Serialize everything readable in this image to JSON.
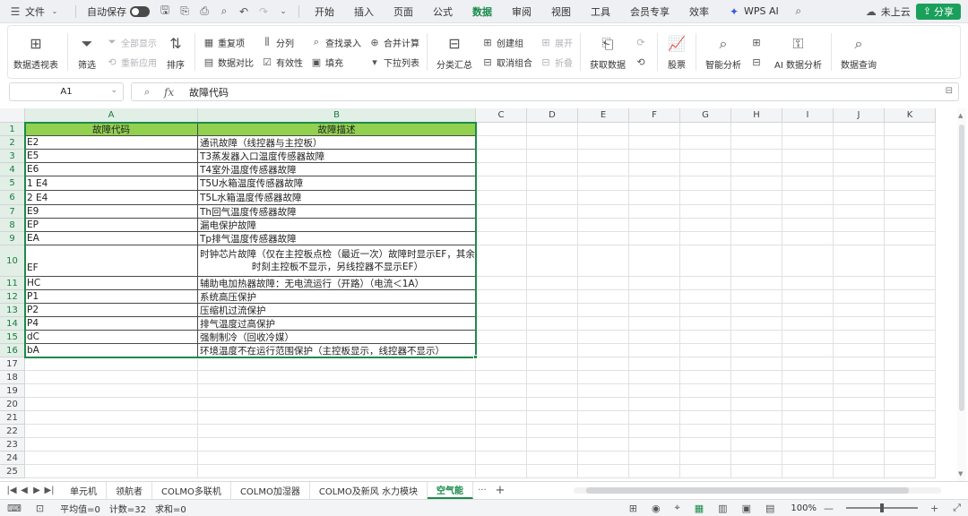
{
  "menubar": {
    "file_label": "文件",
    "autosave_label": "自动保存",
    "tabs": [
      "开始",
      "插入",
      "页面",
      "公式",
      "数据",
      "审阅",
      "视图",
      "工具",
      "会员专享",
      "效率"
    ],
    "active_tab": "数据",
    "wps_ai_label": "WPS AI",
    "cloud_label": "未上云",
    "share_label": "分享",
    "accent_color": "#1a8a4a"
  },
  "ribbon": {
    "pivot_label": "数据透视表",
    "filter_label": "筛选",
    "show_all_label": "全部显示",
    "reapply_label": "重新应用",
    "sort_label": "排序",
    "dedupe_label": "重复项",
    "compare_label": "数据对比",
    "split_label": "分列",
    "validity_label": "有效性",
    "find_entry_label": "查找录入",
    "fill_label": "填充",
    "consolidate_label": "合并计算",
    "dropdown_label": "下拉列表",
    "subtotal_label": "分类汇总",
    "create_group_label": "创建组",
    "ungroup_label": "取消组合",
    "expand_label": "展开",
    "collapse_label": "折叠",
    "get_data_label": "获取数据",
    "stocks_label": "股票",
    "smart_analysis_label": "智能分析",
    "ai_analysis_label": "AI 数据分析",
    "data_query_label": "数据查询"
  },
  "formula_bar": {
    "name_box": "A1",
    "fx_label": "fx",
    "value": "故障代码"
  },
  "grid": {
    "columns": [
      "A",
      "B",
      "C",
      "D",
      "E",
      "F",
      "G",
      "H",
      "I",
      "J",
      "K"
    ],
    "row_numbers": [
      "1",
      "2",
      "3",
      "4",
      "5",
      "6",
      "7",
      "8",
      "9",
      "10",
      "11",
      "12",
      "13",
      "14",
      "15",
      "16",
      "17",
      "18",
      "19",
      "20",
      "21",
      "22",
      "23",
      "24",
      "25"
    ],
    "header_fill": "#92d050",
    "rows": [
      {
        "a": "故障代码",
        "b": "故障描述"
      },
      {
        "a": "E2",
        "b": "通讯故障（线控器与主控板）"
      },
      {
        "a": "E5",
        "b": "T3蒸发器入口温度传感器故障"
      },
      {
        "a": "E6",
        "b": "T4室外温度传感器故障"
      },
      {
        "a": "1  E4",
        "b": "T5U水箱温度传感器故障"
      },
      {
        "a": "2  E4",
        "b": "T5L水箱温度传感器故障"
      },
      {
        "a": "E9",
        "b": "Th回气温度传感器故障"
      },
      {
        "a": "EP",
        "b": "漏电保护故障"
      },
      {
        "a": "EA",
        "b": "Tp排气温度传感器故障"
      },
      {
        "a": "EF",
        "b": "时钟芯片故障（仅在主控板点检（最近一次）故障时显示EF，其余时刻主控板不显示，另线控器不显示EF）"
      },
      {
        "a": "HC",
        "b": "辅助电加热器故障：无电流运行（开路）（电流＜1A）"
      },
      {
        "a": "P1",
        "b": "系统高压保护"
      },
      {
        "a": "P2",
        "b": "压缩机过流保护"
      },
      {
        "a": "P4",
        "b": "排气温度过高保护"
      },
      {
        "a": "dC",
        "b": "强制制冷（回收冷媒）"
      },
      {
        "a": "bA",
        "b": "环境温度不在运行范围保护（主控板显示，线控器不显示）"
      }
    ]
  },
  "sheets": {
    "tabs": [
      "单元机",
      "领航者",
      "COLMO多联机",
      "COLMO加湿器",
      "COLMO及新风 水力模块",
      "空气能"
    ],
    "active": "空气能",
    "more_label": "···",
    "add_label": "+"
  },
  "statusbar": {
    "average": "平均值=0",
    "count": "计数=32",
    "sum": "求和=0",
    "zoom": "100%",
    "zoom_fraction": 0.5
  }
}
